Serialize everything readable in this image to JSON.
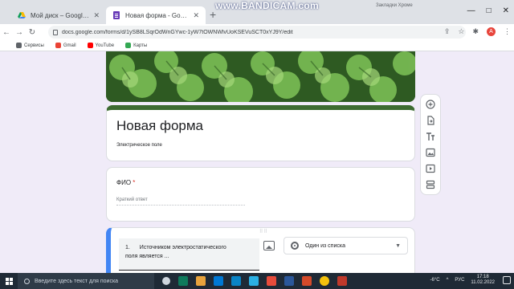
{
  "browser": {
    "tabs": [
      {
        "label": "Мой диск – Google Диск",
        "icon": "google-drive-icon",
        "active": false
      },
      {
        "label": "Новая форма - Google Формы",
        "icon": "google-forms-icon",
        "active": true
      }
    ],
    "new_tab": "+",
    "recording_watermark": "www.BANDICAM.com",
    "profile_label": "Закладки Хроме",
    "url": "docs.google.com/forms/d/1ySB8LSqrOdWnGYwc-1yW7tOWNWlvUoKSEVuSCT0xYJ9Y/edit",
    "bookmarks_left": "Вс",
    "bookmarks": [
      {
        "label": "Сервисы",
        "color": "#5f6368"
      },
      {
        "label": "Gmail",
        "color": "#ea4335"
      },
      {
        "label": "YouTube",
        "color": "#ff0000"
      },
      {
        "label": "Карты",
        "color": "#34a853"
      }
    ],
    "avatar_letter": "A"
  },
  "form": {
    "title": "Новая форма",
    "description": "Электрическое поле",
    "questions": [
      {
        "number": "",
        "text": "ФИО",
        "required_mark": "*",
        "placeholder": "Краткий ответ"
      }
    ],
    "editing_question": {
      "number": "1.",
      "text_line1": "Источником электростатического",
      "text_line2": "поля является ...",
      "type": "Один из списка",
      "drag_handle": "⠿⠿"
    },
    "side_tools": [
      "add-question-icon",
      "import-questions-icon",
      "add-title-icon",
      "add-image-icon",
      "add-video-icon",
      "add-section-icon"
    ],
    "accent_color": "#3d6b31",
    "edit_highlight_color": "#4285f4"
  },
  "taskbar": {
    "search_placeholder": "Введите здесь текст для поиска",
    "weather": "-6°C",
    "language": "РУС",
    "time": "17:18",
    "date": "11.02.2022"
  }
}
